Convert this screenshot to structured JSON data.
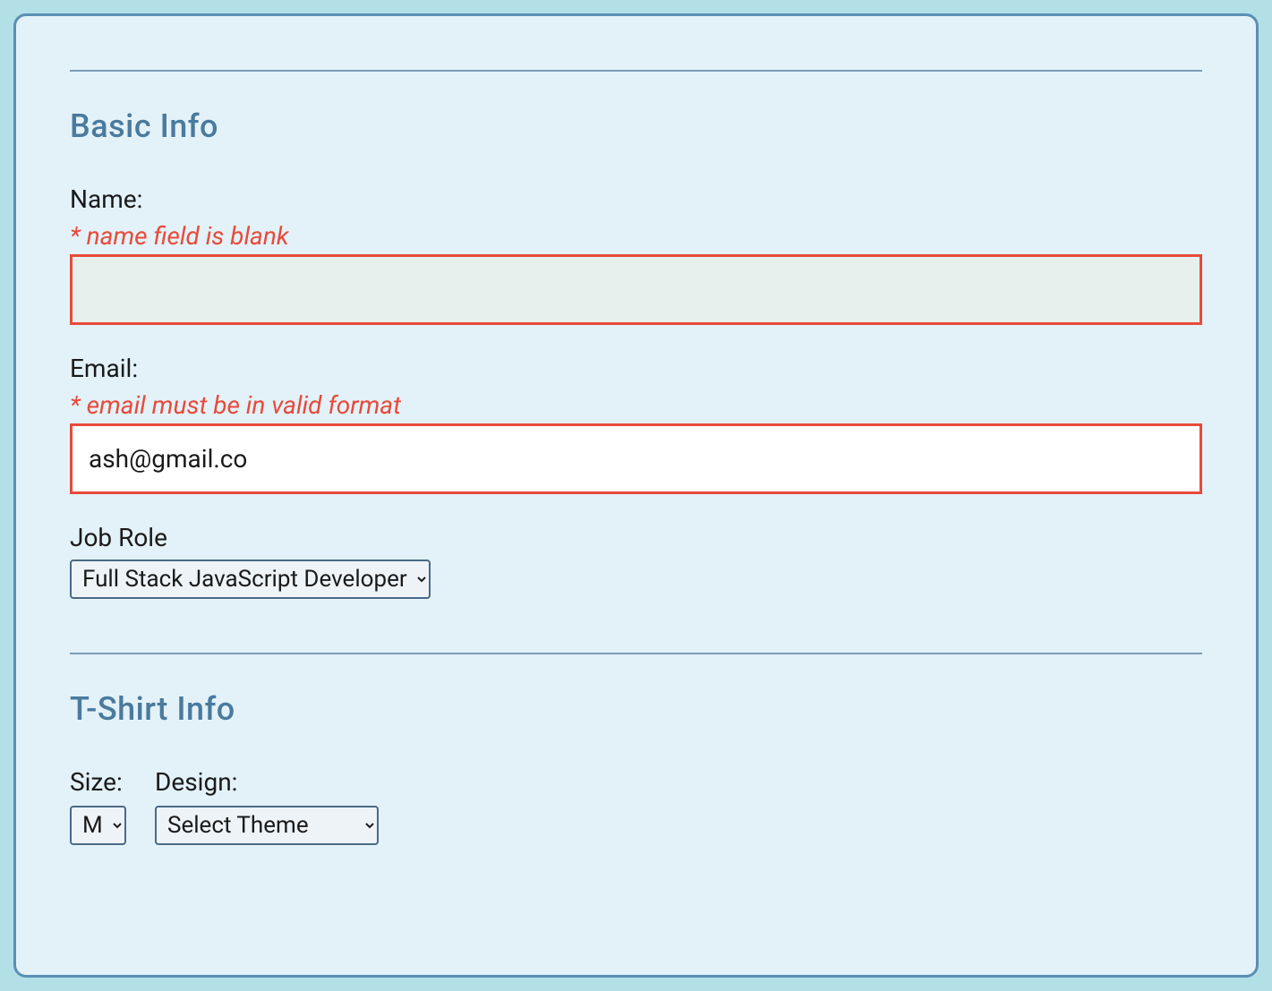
{
  "sections": {
    "basic": {
      "heading": "Basic Info",
      "fields": {
        "name": {
          "label": "Name:",
          "error": "* name field is blank",
          "value": ""
        },
        "email": {
          "label": "Email:",
          "error": "* email must be in valid format",
          "value": "ash@gmail.co"
        },
        "jobRole": {
          "label": "Job Role",
          "selected": "Full Stack JavaScript Developer"
        }
      }
    },
    "tshirt": {
      "heading": "T-Shirt Info",
      "fields": {
        "size": {
          "label": "Size:",
          "selected": "M"
        },
        "design": {
          "label": "Design:",
          "selected": "Select Theme"
        }
      }
    }
  },
  "colors": {
    "error": "#e84a3a",
    "accent": "#5a8fb5",
    "heading": "#4a7a9d"
  }
}
